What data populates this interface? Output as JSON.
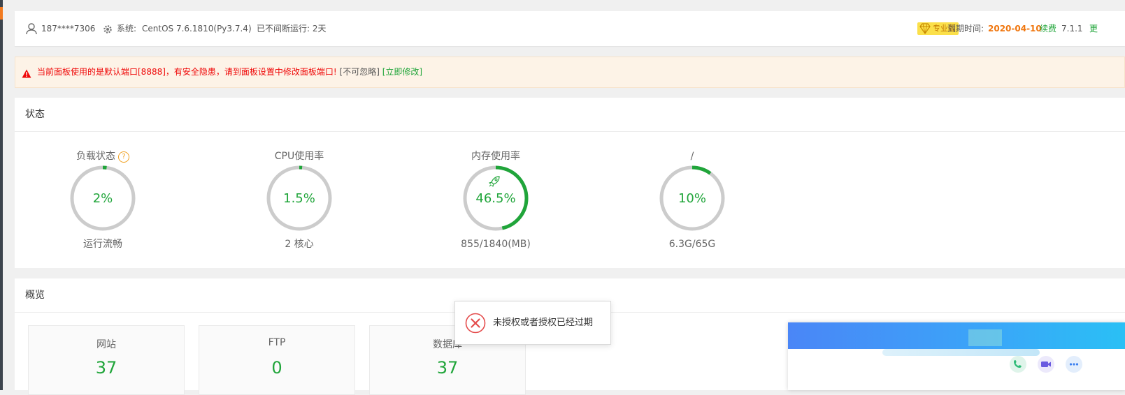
{
  "topbar": {
    "user": "187****7306",
    "system_label": "系统:",
    "system_value": "CentOS 7.6.1810(Py3.7.4)",
    "uptime": "已不间断运行: 2天",
    "edition": "专业版",
    "expire_label": "到期时间:",
    "expire_date": "2020-04-10",
    "renew": "续费",
    "version": "7.1.1",
    "update": "更"
  },
  "alert": {
    "warning": "当前面板使用的是默认端口[8888]，有安全隐患，请到面板设置中修改面板端口!",
    "ignore": "[不可忽略]",
    "fix": "[立即修改]"
  },
  "status": {
    "title": "状态",
    "gauges": [
      {
        "title": "负载状态",
        "value": "2%",
        "percent": 2,
        "sub": "运行流畅",
        "help": "?"
      },
      {
        "title": "CPU使用率",
        "value": "1.5%",
        "percent": 1.5,
        "sub": "2 核心"
      },
      {
        "title": "内存使用率",
        "value": "46.5%",
        "percent": 46.5,
        "sub": "855/1840(MB)"
      },
      {
        "title": "/",
        "value": "10%",
        "percent": 10,
        "sub": "6.3G/65G"
      }
    ]
  },
  "overview": {
    "title": "概览",
    "items": [
      {
        "label": "网站",
        "value": "37"
      },
      {
        "label": "FTP",
        "value": "0"
      },
      {
        "label": "数据库",
        "value": "37"
      }
    ]
  },
  "toast": {
    "message": "未授权或者授权已经过期"
  },
  "colors": {
    "accent": "#20a53a",
    "warning": "#ef0808",
    "expire": "#f0760e",
    "gauge_track": "#cccccc"
  },
  "icons": [
    "user-icon",
    "gear-icon",
    "diamond-icon",
    "warning-icon",
    "help-icon",
    "rocket-icon",
    "error-icon",
    "phone-icon",
    "video-icon",
    "more-icon"
  ]
}
